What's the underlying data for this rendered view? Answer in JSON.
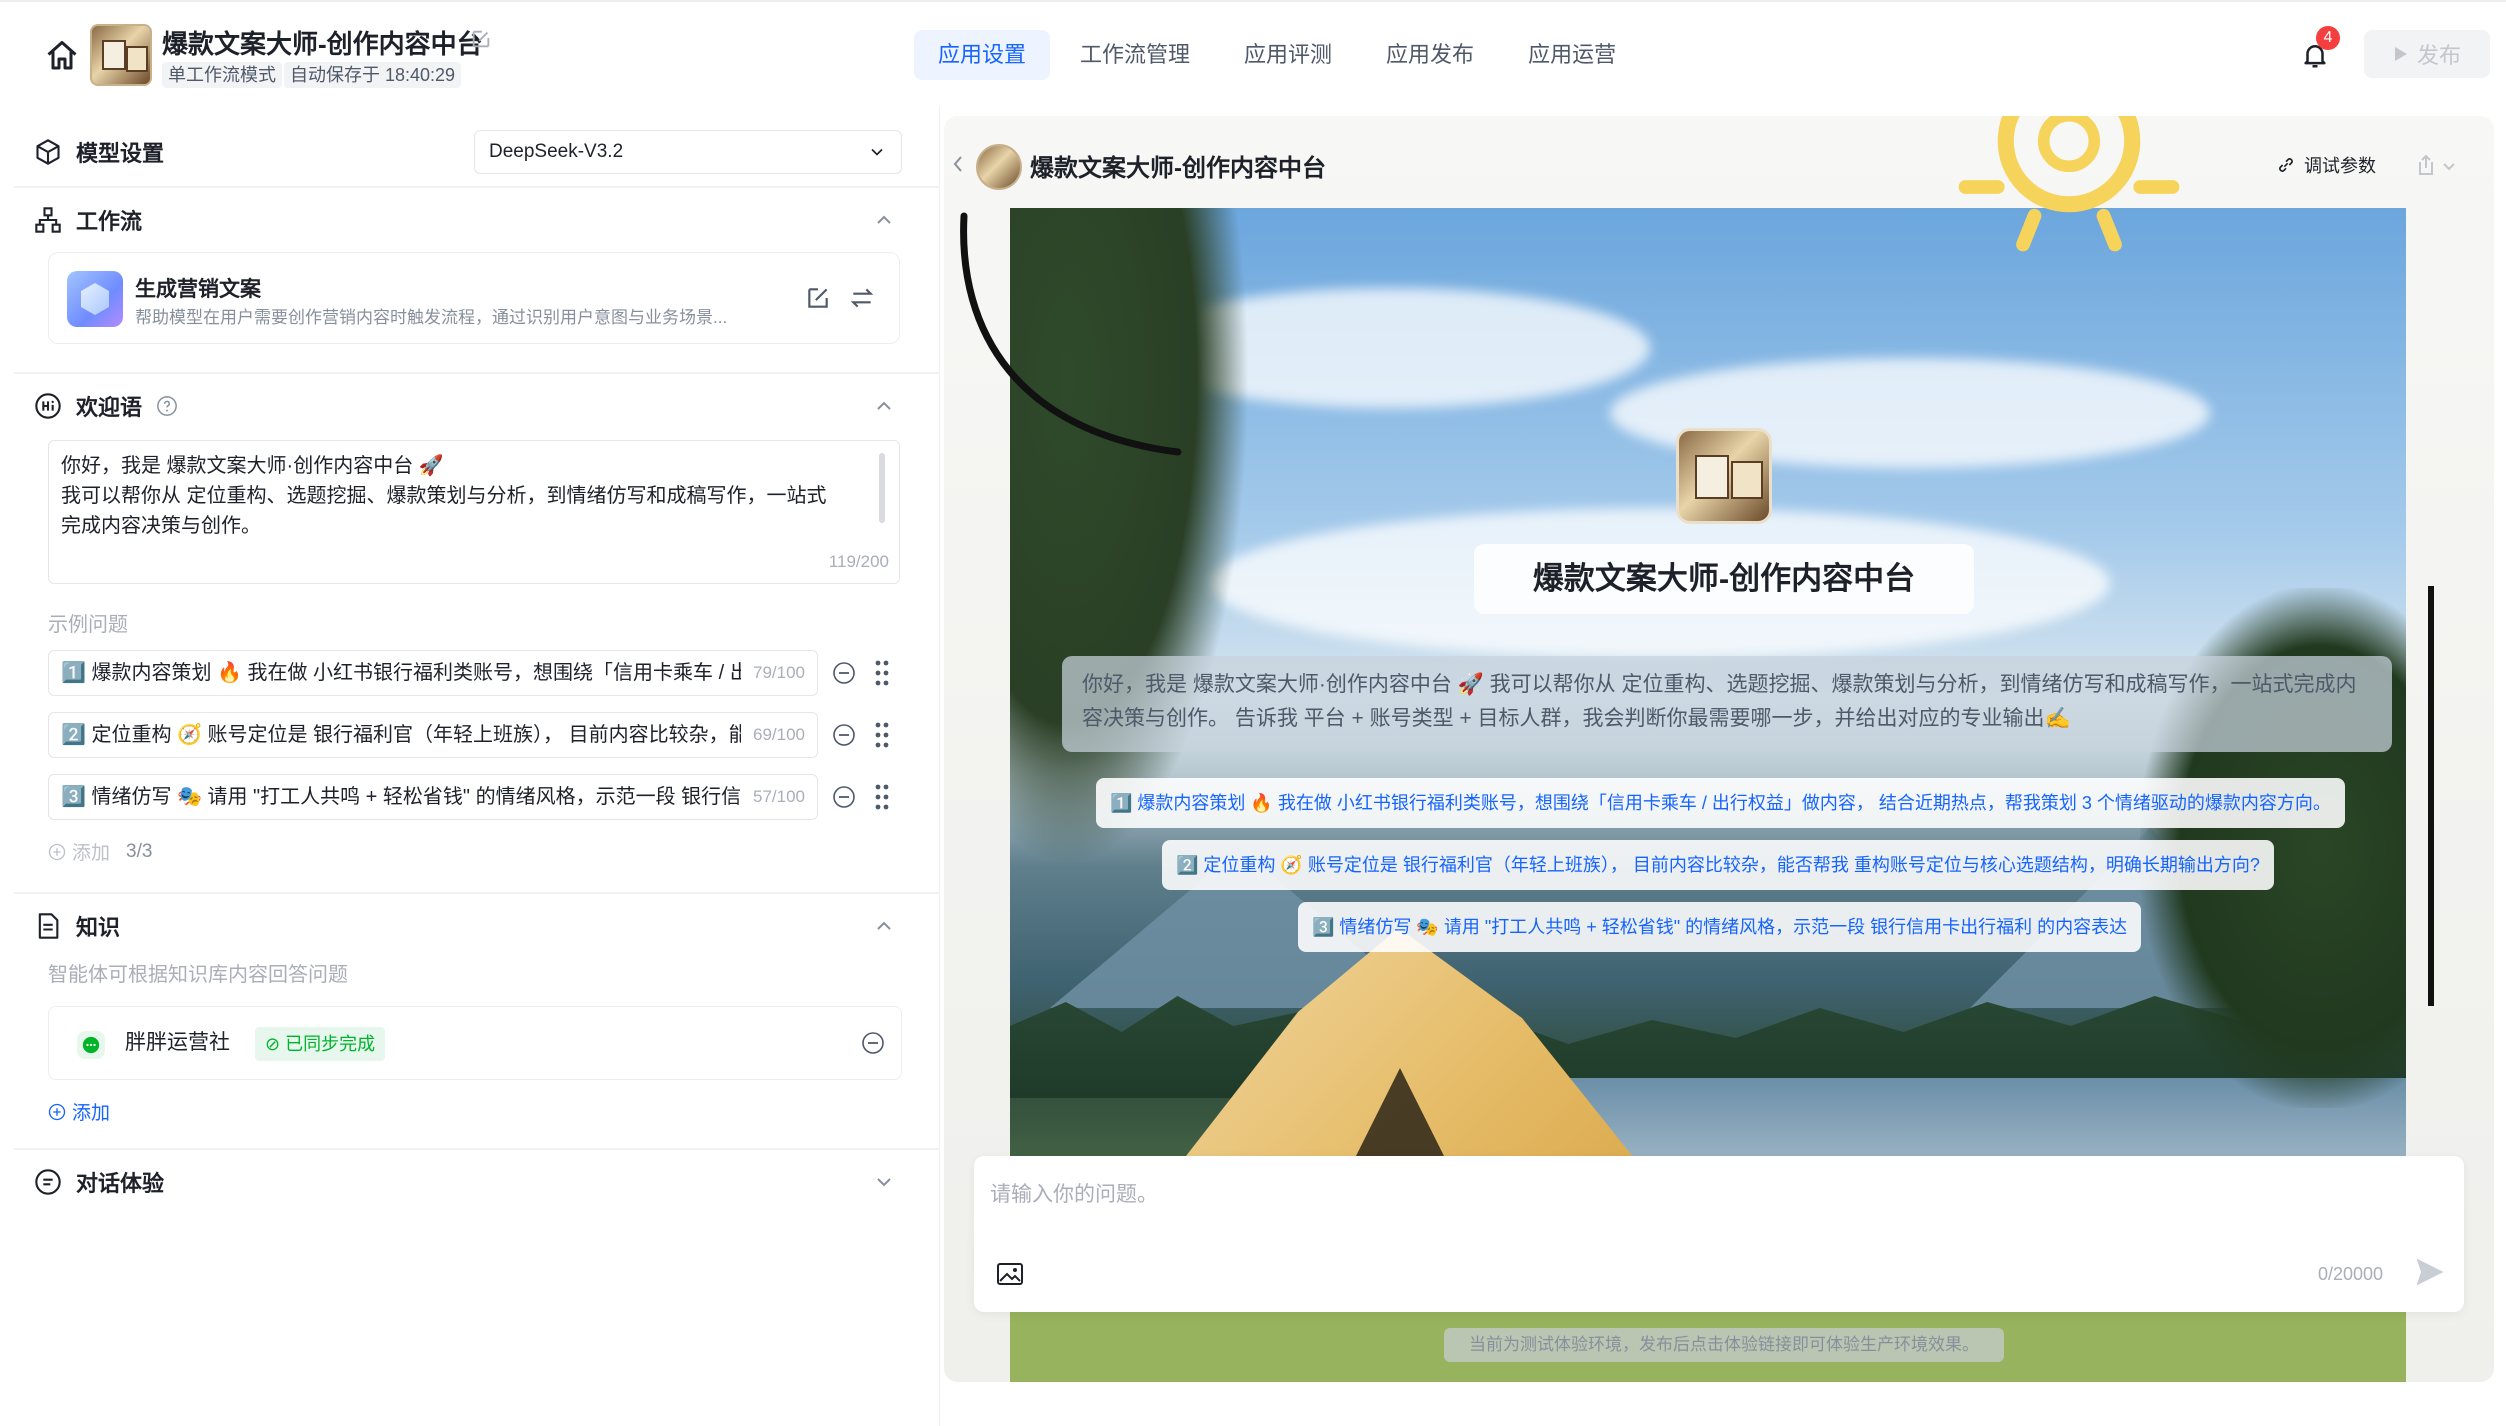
{
  "header": {
    "title": "爆款文案大师-创作内容中台",
    "tags": [
      "单工作流模式",
      "自动保存于 18:40:29"
    ],
    "tabs": [
      {
        "label": "应用设置",
        "active": true
      },
      {
        "label": "工作流管理",
        "active": false
      },
      {
        "label": "应用评测",
        "active": false
      },
      {
        "label": "应用发布",
        "active": false
      },
      {
        "label": "应用运营",
        "active": false
      }
    ],
    "notification_count": "4",
    "publish_label": "发布"
  },
  "left": {
    "model": {
      "title": "模型设置",
      "selected": "DeepSeek-V3.2"
    },
    "workflow": {
      "title": "工作流",
      "item_name": "生成营销文案",
      "item_desc": "帮助模型在用户需要创作营销内容时触发流程，通过识别用户意图与业务场景..."
    },
    "welcome": {
      "title": "欢迎语",
      "lines": [
        "你好，我是  爆款文案大师·创作内容中台 🚀",
        "我可以帮你从  定位重构、选题挖掘、爆款策划与分析，到情绪仿写和成稿写作，一站式",
        "完成内容决策与创作。"
      ],
      "count": "119/200"
    },
    "examples": {
      "label": "示例问题",
      "items": [
        {
          "text": "1️⃣ 爆款内容策划 🔥  我在做 小红书银行福利类账号，想围绕「信用卡乘车 / 出行权益」做内容",
          "count": "79/100"
        },
        {
          "text": "2️⃣ 定位重构 🧭  账号定位是 银行福利官（年轻上班族），  目前内容比较杂，能否帮我",
          "count": "69/100"
        },
        {
          "text": "3️⃣ 情绪仿写 🎭  请用 \"打工人共鸣 + 轻松省钱\" 的情绪风格，示范一段 银行信用卡出行福利",
          "count": "57/100"
        }
      ],
      "add_label": "添加",
      "add_count": "3/3"
    },
    "knowledge": {
      "title": "知识",
      "desc": "智能体可根据知识库内容回答问题",
      "item_name": "胖胖运营社",
      "item_status": "已同步完成",
      "add_label": "添加"
    },
    "chat": {
      "title": "对话体验"
    }
  },
  "preview": {
    "title": "爆款文案大师-创作内容中台",
    "debug_label": "调试参数",
    "bot_name": "爆款文案大师-创作内容中台",
    "intro": "你好，我是 爆款文案大师·创作内容中台 🚀 我可以帮你从 定位重构、选题挖掘、爆款策划与分析，到情绪仿写和成稿写作，一站式完成内容决策与创作。 告诉我 平台 + 账号类型 + 目标人群，我会判断你最需要哪一步，并给出对应的专业输出✍️",
    "chips": [
      "1️⃣ 爆款内容策划 🔥 我在做 小红书银行福利类账号，想围绕「信用卡乘车 / 出行权益」做内容， 结合近期热点，帮我策划 3 个情绪驱动的爆款内容方向。",
      "2️⃣ 定位重构 🧭 账号定位是 银行福利官（年轻上班族）， 目前内容比较杂，能否帮我 重构账号定位与核心选题结构，明确长期输出方向?",
      "3️⃣ 情绪仿写 🎭 请用 \"打工人共鸣 + 轻松省钱\" 的情绪风格，示范一段 银行信用卡出行福利 的内容表达"
    ],
    "input_placeholder": "请输入你的问题。",
    "input_count": "0/20000",
    "footer_note": "当前为测试体验环境，发布后点击体验链接即可体验生产环境效果。"
  },
  "colors": {
    "accent": "#1664ff",
    "success": "#00b42a",
    "badge": "#f53f3f"
  }
}
